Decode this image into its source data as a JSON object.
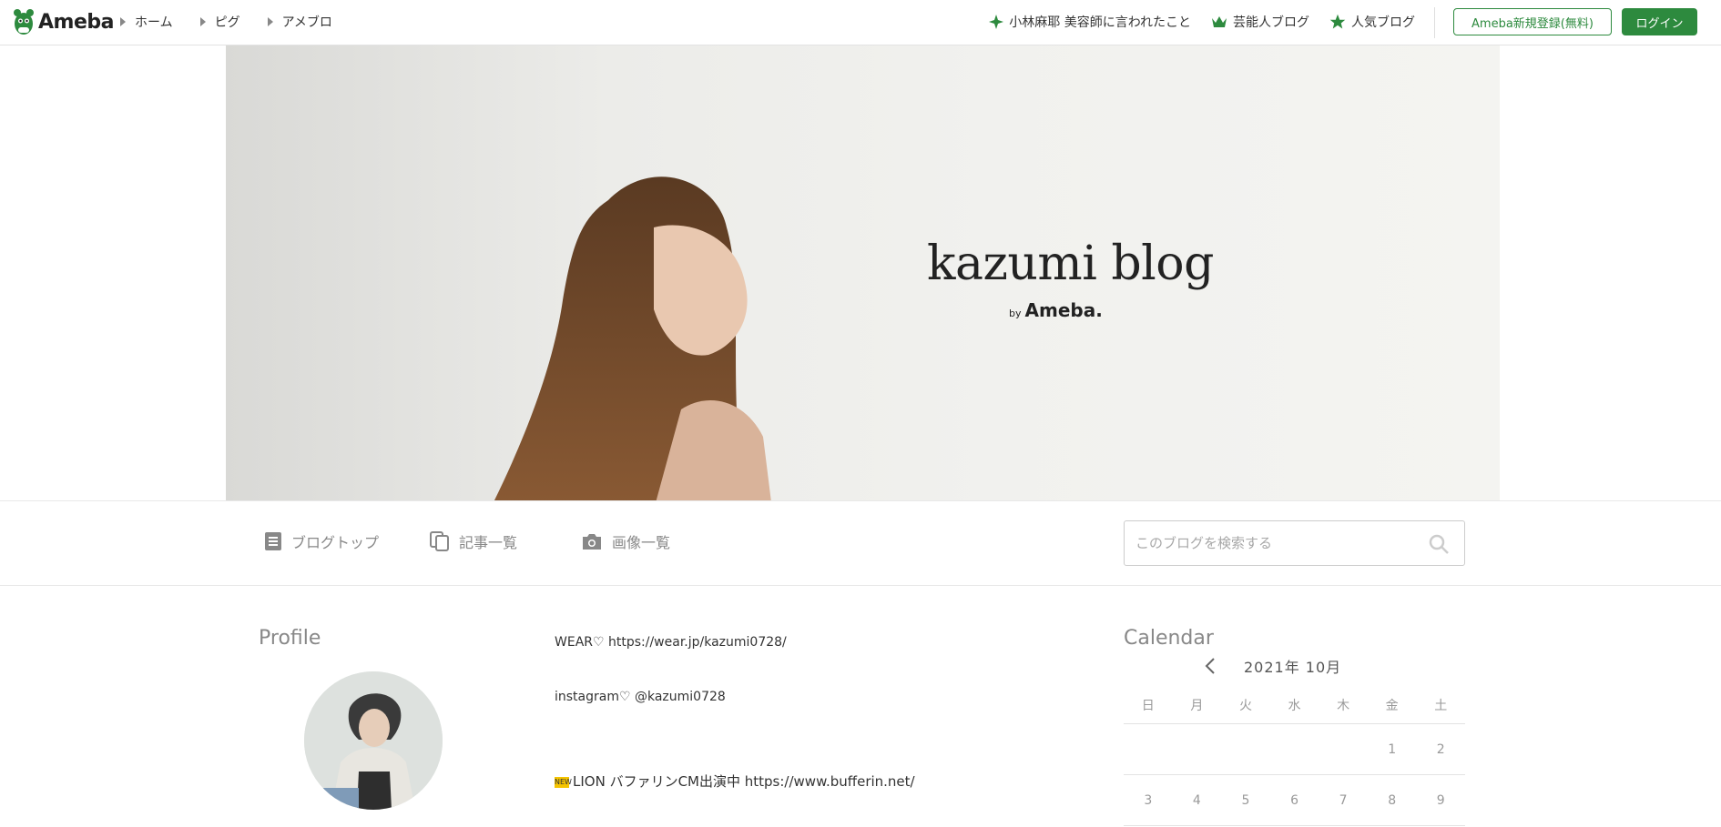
{
  "topbar": {
    "logo_text": "Ameba",
    "nav": [
      {
        "label": "ホーム"
      },
      {
        "label": "ピグ"
      },
      {
        "label": "アメブロ"
      }
    ],
    "right_links": [
      {
        "label": "小林麻耶 美容師に言われたこと",
        "icon": "sparkle-icon"
      },
      {
        "label": "芸能人ブログ",
        "icon": "crown-icon"
      },
      {
        "label": "人気ブログ",
        "icon": "star-icon"
      }
    ],
    "register_label": "Ameba新規登録(無料)",
    "login_label": "ログイン"
  },
  "header": {
    "title": "kazumi blog",
    "by": "by",
    "brand": "Ameba."
  },
  "subnav": {
    "items": [
      {
        "label": "ブログトップ",
        "icon": "document-icon"
      },
      {
        "label": "記事一覧",
        "icon": "copy-icon"
      },
      {
        "label": "画像一覧",
        "icon": "camera-icon"
      }
    ],
    "search_placeholder": "このブログを検索する"
  },
  "profile": {
    "heading": "Profile",
    "bio_lines": [
      "WEAR♡ https://wear.jp/kazumi0728/",
      "instagram♡ @kazumi0728",
      "LION バファリンCM出演中 https://www.bufferin.net/"
    ],
    "new_badge": "NEW"
  },
  "calendar": {
    "heading": "Calendar",
    "month_label": "2021年 10月",
    "weekdays": [
      "日",
      "月",
      "火",
      "水",
      "木",
      "金",
      "土"
    ],
    "rows": [
      [
        "",
        "",
        "",
        "",
        "",
        "1",
        "2"
      ],
      [
        "3",
        "4",
        "5",
        "6",
        "7",
        "8",
        "9"
      ]
    ]
  },
  "colors": {
    "accent": "#2d8a3e"
  }
}
